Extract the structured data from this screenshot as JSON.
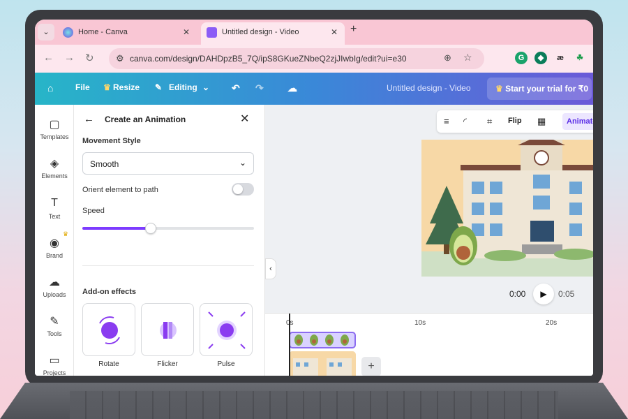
{
  "browser": {
    "tab_dropdown": "⌄",
    "tabs": [
      {
        "label": "Home - Canva",
        "close": "✕"
      },
      {
        "label": "Untitled design - Video",
        "close": "✕"
      }
    ],
    "new_tab": "+",
    "url": "canva.com/design/DAHDpzB5_7Q/ipS8GKueZNbeQ2zjJIwbIg/edit?ui=e30",
    "extensions": [
      "G",
      "◆",
      "æ",
      "☘"
    ]
  },
  "canva_header": {
    "file": "File",
    "resize": "Resize",
    "editing": "Editing",
    "doc_title": "Untitled design - Video",
    "trial": "Start your trial for ₹0"
  },
  "rail": [
    {
      "label": "Templates",
      "icon": "▢"
    },
    {
      "label": "Elements",
      "icon": "◈"
    },
    {
      "label": "Text",
      "icon": "T"
    },
    {
      "label": "Brand",
      "icon": "◉"
    },
    {
      "label": "Uploads",
      "icon": "☁"
    },
    {
      "label": "Tools",
      "icon": "✎"
    },
    {
      "label": "Projects",
      "icon": "▭"
    }
  ],
  "panel": {
    "title": "Create an Animation",
    "movement_style_label": "Movement Style",
    "movement_style_value": "Smooth",
    "orient_label": "Orient element to path",
    "orient_enabled": false,
    "speed_label": "Speed",
    "speed_fraction": 0.4,
    "addon_label": "Add-on effects",
    "effects": [
      "Rotate",
      "Flicker",
      "Pulse"
    ]
  },
  "workspace": {
    "toolbar": {
      "flip": "Flip",
      "animate": "Animate"
    },
    "time_current": "0:00",
    "time_total": "0:05",
    "ticks": [
      "0s",
      "10s",
      "20s"
    ],
    "add_track": "+"
  },
  "colors": {
    "accent": "#7d3cff",
    "header_start": "#27b5c8",
    "header_end": "#6b5ad8",
    "tab_bar": "#f9c6d4"
  }
}
